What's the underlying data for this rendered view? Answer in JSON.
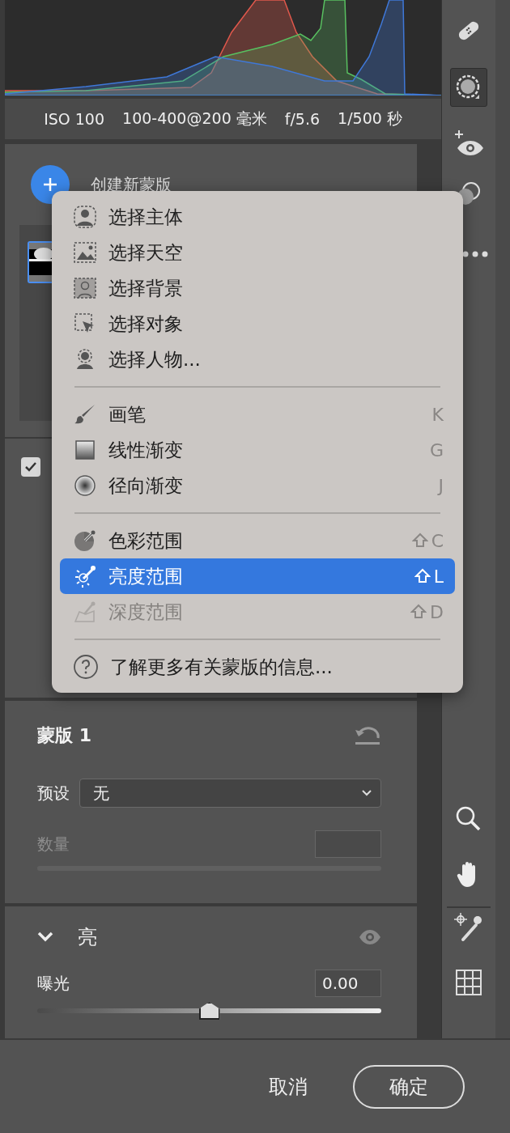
{
  "camera_info": [
    "ISO 100",
    "100-400@200 毫米",
    "f/5.6",
    "1/500 秒"
  ],
  "masks_panel": {
    "create_label": "创建新蒙版",
    "options": [
      {
        "checked": true
      }
    ]
  },
  "menu": {
    "groups": [
      [
        {
          "label": "选择主体",
          "selected": false,
          "disabled": false
        },
        {
          "label": "选择天空",
          "selected": false,
          "disabled": false
        },
        {
          "label": "选择背景",
          "selected": false,
          "disabled": false
        },
        {
          "label": "选择对象",
          "selected": false,
          "disabled": false
        },
        {
          "label": "选择人物...",
          "selected": false,
          "disabled": false
        }
      ],
      [
        {
          "label": "画笔",
          "shortcut": "K",
          "shift": false,
          "selected": false,
          "disabled": false
        },
        {
          "label": "线性渐变",
          "shortcut": "G",
          "shift": false,
          "selected": false,
          "disabled": false
        },
        {
          "label": "径向渐变",
          "shortcut": "J",
          "shift": false,
          "selected": false,
          "disabled": false
        }
      ],
      [
        {
          "label": "色彩范围",
          "shortcut": "C",
          "shift": true,
          "selected": false,
          "disabled": false
        },
        {
          "label": "亮度范围",
          "shortcut": "L",
          "shift": true,
          "selected": true,
          "disabled": false
        },
        {
          "label": "深度范围",
          "shortcut": "D",
          "shift": true,
          "selected": false,
          "disabled": true
        }
      ],
      [
        {
          "label": "了解更多有关蒙版的信息...",
          "selected": false,
          "disabled": false
        }
      ]
    ]
  },
  "mask_settings": {
    "title": "蒙版 1",
    "preset_label": "预设",
    "preset_value": "无",
    "amount_label": "数量",
    "amount_disabled": true
  },
  "section": {
    "title": "亮",
    "expanded": true,
    "sliders": [
      {
        "label": "曝光",
        "value": "0.00",
        "level": 0.5
      }
    ]
  },
  "toolbar": [
    {
      "selected": false
    },
    {
      "selected": true
    },
    {
      "selected": false
    },
    {
      "selected": false
    },
    {
      "selected": false
    },
    {
      "selected": false
    },
    {
      "selected": false
    },
    {
      "selected": false
    },
    {
      "selected": false
    }
  ],
  "footer": {
    "cancel": "取消",
    "ok": "确定"
  }
}
